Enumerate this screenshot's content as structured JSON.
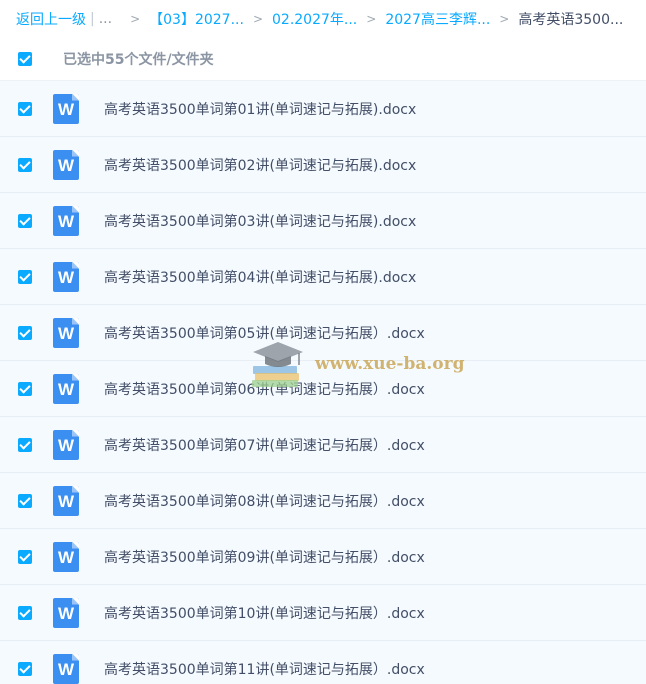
{
  "breadcrumb": {
    "back": "返回上一级",
    "pipe": "|",
    "ellipsis": "...",
    "items": [
      "【03】2027...",
      "02.2027年...",
      "2027高三李辉..."
    ],
    "current": "高考英语3500...",
    "separator": ">"
  },
  "selection": {
    "count_label": "已选中55个文件/文件夹"
  },
  "files": [
    {
      "name": "高考英语3500单词第01讲(单词速记与拓展).docx",
      "icon": "word-doc-icon",
      "icon_letter": "W"
    },
    {
      "name": "高考英语3500单词第02讲(单词速记与拓展).docx",
      "icon": "word-doc-icon",
      "icon_letter": "W"
    },
    {
      "name": "高考英语3500单词第03讲(单词速记与拓展).docx",
      "icon": "word-doc-icon",
      "icon_letter": "W"
    },
    {
      "name": "高考英语3500单词第04讲(单词速记与拓展).docx",
      "icon": "word-doc-icon",
      "icon_letter": "W"
    },
    {
      "name": "高考英语3500单词第05讲(单词速记与拓展）.docx",
      "icon": "word-doc-icon",
      "icon_letter": "W"
    },
    {
      "name": "高考英语3500单词第06讲(单词速记与拓展）.docx",
      "icon": "word-doc-icon",
      "icon_letter": "W"
    },
    {
      "name": "高考英语3500单词第07讲(单词速记与拓展）.docx",
      "icon": "word-doc-icon",
      "icon_letter": "W"
    },
    {
      "name": "高考英语3500单词第08讲(单词速记与拓展）.docx",
      "icon": "word-doc-icon",
      "icon_letter": "W"
    },
    {
      "name": "高考英语3500单词第09讲(单词速记与拓展）.docx",
      "icon": "word-doc-icon",
      "icon_letter": "W"
    },
    {
      "name": "高考英语3500单词第10讲(单词速记与拓展）.docx",
      "icon": "word-doc-icon",
      "icon_letter": "W"
    },
    {
      "name": "高考英语3500单词第11讲(单词速记与拓展）.docx",
      "icon": "word-doc-icon",
      "icon_letter": "W"
    }
  ],
  "watermark": {
    "text": "www.xue-ba.org",
    "logo": "graduation-cap-books-icon"
  },
  "colors": {
    "accent": "#09aaff",
    "text": "#424e67",
    "muted": "#8b95a3",
    "row_bg": "#f5fafe",
    "word_icon": "#3b8ff0"
  }
}
